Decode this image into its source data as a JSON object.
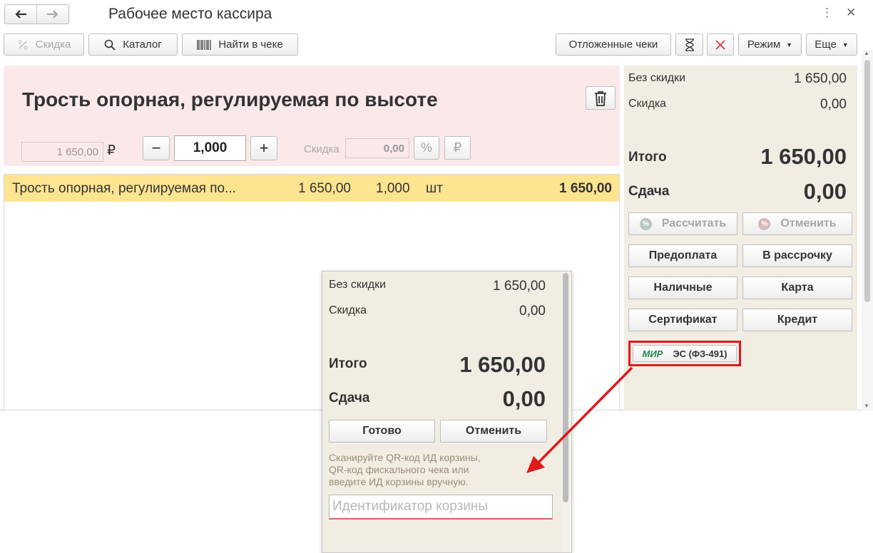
{
  "window": {
    "title": "Рабочее место кассира",
    "back_icon": "arrow-left-icon",
    "forward_icon": "arrow-right-icon",
    "menu_glyph": "⋮",
    "close_glyph": "✕"
  },
  "toolbar": {
    "discount_label": "Скидка",
    "catalog_label": "Каталог",
    "find_label": "Найти в чеке",
    "deferred_label": "Отложенные чеки",
    "mode_label": "Режим",
    "more_label": "Еще"
  },
  "product": {
    "title": "Трость опорная, регулируемая по высоте",
    "price": "1 650,00",
    "currency": "₽",
    "quantity": "1,000",
    "minus": "−",
    "plus": "+",
    "discount_label": "Скидка",
    "discount_value": "0,00",
    "percent_glyph": "%",
    "ruble_glyph": "₽"
  },
  "receipt": {
    "rows": [
      {
        "name": "Трость опорная, регулируемая по...",
        "price": "1 650,00",
        "qty": "1,000",
        "unit": "шт",
        "sum": "1 650,00"
      }
    ]
  },
  "summary": {
    "no_discount_label": "Без скидки",
    "no_discount_value": "1 650,00",
    "discount_label": "Скидка",
    "discount_value": "0,00",
    "total_label": "Итого",
    "total_value": "1 650,00",
    "change_label": "Сдача",
    "change_value": "0,00",
    "calc_label": "Рассчитать",
    "cancel_label": "Отменить",
    "prepay_label": "Предоплата",
    "installment_label": "В рассрочку",
    "cash_label": "Наличные",
    "card_label": "Карта",
    "certificate_label": "Сертификат",
    "credit_label": "Кредит",
    "mir_logo": "МИР",
    "es_label": "ЭС (ФЗ-491)"
  },
  "popup": {
    "no_discount_label": "Без скидки",
    "no_discount_value": "1 650,00",
    "discount_label": "Скидка",
    "discount_value": "0,00",
    "total_label": "Итого",
    "total_value": "1 650,00",
    "change_label": "Сдача",
    "change_value": "0,00",
    "done_label": "Готово",
    "cancel_label": "Отменить",
    "hint_line1": "Сканируйте QR-код ИД корзины,",
    "hint_line2": "QR-код фискального чека или",
    "hint_line3": "введите ИД корзины вручную.",
    "basket_placeholder": "Идентификатор корзины"
  },
  "colors": {
    "product_bg": "#fbe9e9",
    "row_highlight": "#fde490",
    "summary_bg": "#f1ede3",
    "annotation_red": "#e0191a",
    "mir_green": "#1f8a4c"
  }
}
